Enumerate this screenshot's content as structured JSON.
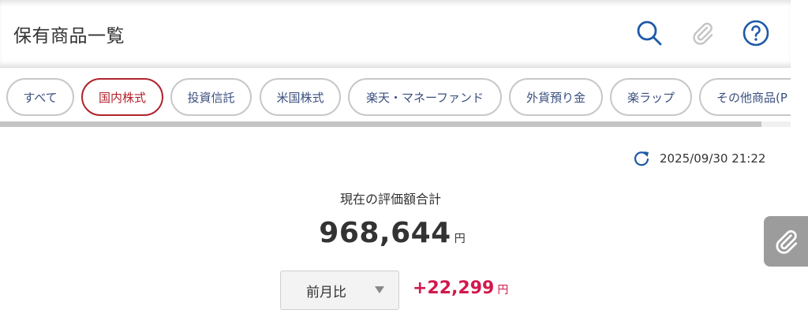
{
  "header": {
    "title": "保有商品一覧",
    "icons": [
      "search-icon",
      "paperclip-icon",
      "help-icon"
    ]
  },
  "tabs": [
    {
      "label": "すべて",
      "active": false
    },
    {
      "label": "国内株式",
      "active": true
    },
    {
      "label": "投資信託",
      "active": false
    },
    {
      "label": "米国株式",
      "active": false
    },
    {
      "label": "楽天・マネーファンド",
      "active": false
    },
    {
      "label": "外貨預り金",
      "active": false
    },
    {
      "label": "楽ラップ",
      "active": false
    },
    {
      "label": "その他商品(P",
      "active": false
    }
  ],
  "updated": {
    "timestamp": "2025/09/30 21:22",
    "icon": "refresh-icon"
  },
  "summary": {
    "label": "現在の評価額合計",
    "value": "968,644",
    "unit": "円"
  },
  "compare": {
    "selected": "前月比",
    "change": "+22,299",
    "unit": "円"
  },
  "colors": {
    "accent_blue": "#1e5aa8",
    "active_red": "#b0242d",
    "positive_change": "#d2184d",
    "chip_text": "#3a4f7f"
  }
}
